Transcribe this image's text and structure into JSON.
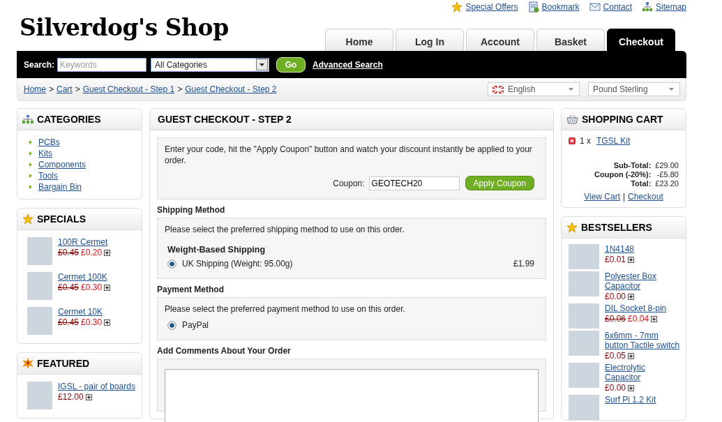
{
  "top_links": [
    {
      "label": "Special Offers",
      "kind": "star"
    },
    {
      "label": "Bookmark",
      "kind": "bookmark"
    },
    {
      "label": "Contact",
      "kind": "mail"
    },
    {
      "label": "Sitemap",
      "kind": "sitemap"
    }
  ],
  "logo": "Silverdog's Shop",
  "tabs": [
    {
      "label": "Home",
      "selected": false
    },
    {
      "label": "Log In",
      "selected": false
    },
    {
      "label": "Account",
      "selected": false
    },
    {
      "label": "Basket",
      "selected": false
    },
    {
      "label": "Checkout",
      "selected": true
    }
  ],
  "search": {
    "label": "Search:",
    "placeholder": "Keywords",
    "category": "All Categories",
    "button": "Go",
    "advanced": "Advanced Search"
  },
  "breadcrumb": {
    "separator": ">",
    "items": [
      "Home",
      "Cart",
      "Guest Checkout - Step 1",
      "Guest Checkout - Step 2"
    ]
  },
  "language": "English",
  "currency": "Pound Sterling",
  "categories": {
    "title": "CATEGORIES",
    "items": [
      "PCBs",
      "Kits",
      "Components",
      "Tools",
      "Bargain Bin"
    ]
  },
  "specials": {
    "title": "SPECIALS",
    "products": [
      {
        "name": "100R Cermet",
        "old_price": "£0.45",
        "price": "£0.20"
      },
      {
        "name": "Cermet 100K",
        "old_price": "£0.45",
        "price": "£0.30"
      },
      {
        "name": "Cermet 10K",
        "old_price": "£0.45",
        "price": "£0.30"
      }
    ]
  },
  "featured": {
    "title": "FEATURED",
    "products": [
      {
        "name": "IGSL - pair of boards",
        "price": "£12.00"
      }
    ]
  },
  "checkout": {
    "title": "GUEST CHECKOUT - STEP 2",
    "coupon": {
      "text": "Enter your code, hit the \"Apply Coupon\" button and watch your discount instantly be applied to your order.",
      "label": "Coupon:",
      "value": "GEOTECH20",
      "button": "Apply Coupon"
    },
    "shipping": {
      "heading": "Shipping Method",
      "text": "Please select the preferred shipping method to use on this order.",
      "group": "Weight-Based Shipping",
      "options": [
        {
          "label": "UK Shipping (Weight: 95.00g)",
          "price": "£1.99",
          "selected": true
        }
      ]
    },
    "payment": {
      "heading": "Payment Method",
      "text": "Please select the preferred payment method to use on this order.",
      "options": [
        {
          "label": "PayPal",
          "selected": true
        }
      ]
    },
    "comments": {
      "heading": "Add Comments About Your Order"
    }
  },
  "cart": {
    "title": "SHOPPING CART",
    "items": [
      {
        "quantity": "1 x",
        "name": "TGSL Kit"
      }
    ],
    "totals": [
      {
        "label": "Sub-Total:",
        "value": "£29.00"
      },
      {
        "label": "Coupon (-20%):",
        "value": "-£5.80"
      },
      {
        "label": "Total:",
        "value": "£23.20"
      }
    ],
    "links": [
      "View Cart",
      "Checkout"
    ],
    "link_separator": "|"
  },
  "bestsellers": {
    "title": "BESTSELLERS",
    "products": [
      {
        "name": "1N4148",
        "price": "£0.01"
      },
      {
        "name": "Polyester Box Capacitor",
        "price": "£0.00"
      },
      {
        "name": "DIL Socket 8-pin",
        "old_price": "£0.06",
        "price": "£0.04"
      },
      {
        "name": "6x6mm - 7mm button Tactile switch",
        "price": "£0.05"
      },
      {
        "name": "Electrolytic Capacitor",
        "price": "£0.00"
      },
      {
        "name": "Surf Pi 1.2 Kit"
      }
    ]
  }
}
